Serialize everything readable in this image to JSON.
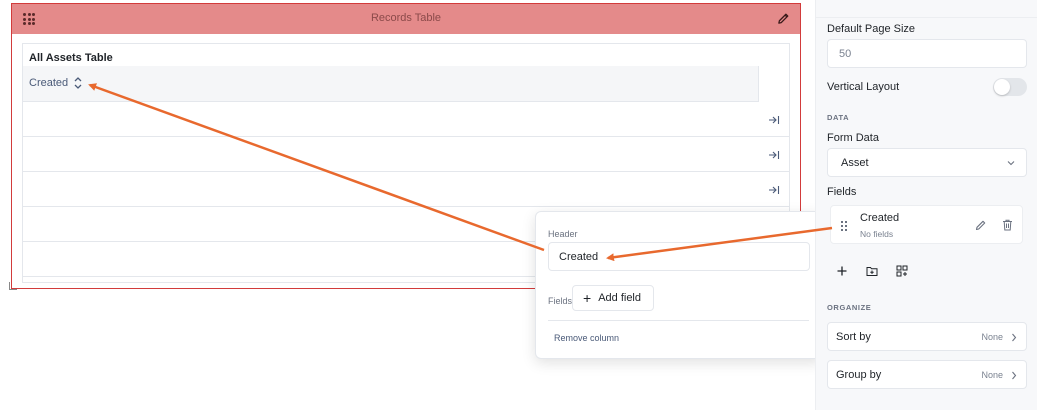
{
  "widget": {
    "title": "Records Table",
    "table_title": "All Assets Table",
    "column_header": "Created",
    "row_count": 5
  },
  "popover": {
    "header_label": "Header",
    "header_value": "Created",
    "fields_label": "Fields",
    "add_field_label": "Add field",
    "remove_column_label": "Remove column"
  },
  "panel": {
    "default_page_size_label": "Default Page Size",
    "default_page_size_value": "50",
    "vertical_layout_label": "Vertical Layout",
    "vertical_layout_on": false,
    "data_section": "DATA",
    "form_data_label": "Form Data",
    "form_data_value": "Asset",
    "fields_label": "Fields",
    "field_item": {
      "name": "Created",
      "sub": "No fields"
    },
    "organize_section": "ORGANIZE",
    "sort_by": {
      "label": "Sort by",
      "value": "None"
    },
    "group_by": {
      "label": "Group by",
      "value": "None"
    }
  },
  "colors": {
    "widget_header": "#e48a8a",
    "widget_border": "#d23b3b",
    "arrow": "#e8692e"
  },
  "icons": [
    "drag-grid-icon",
    "pencil-icon",
    "sort-icon",
    "collapse-right-icon",
    "chevron-down-icon",
    "grip-icon",
    "trash-icon",
    "plus-icon",
    "add-folder-icon",
    "add-grid-icon",
    "chevron-right-icon"
  ]
}
